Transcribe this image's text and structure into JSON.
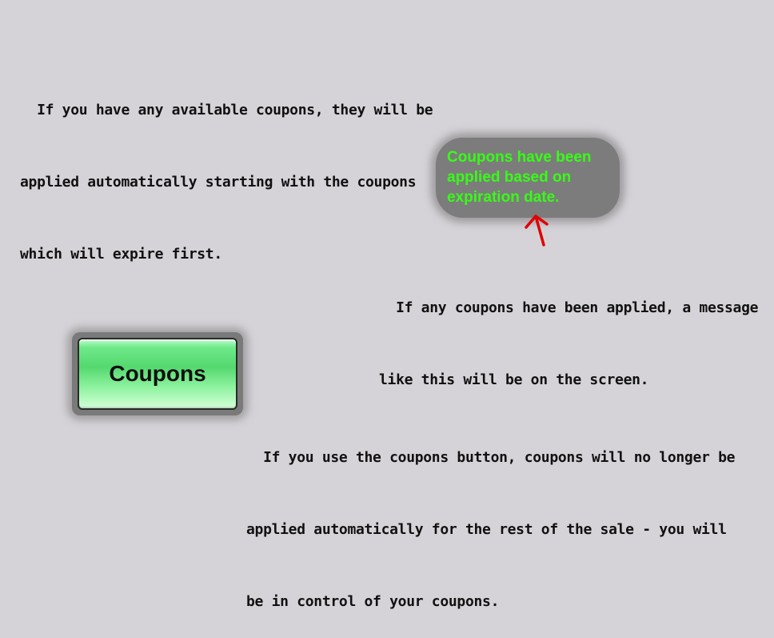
{
  "notes": {
    "auto_apply": [
      "  If you have any available coupons, they will be",
      "applied automatically starting with the coupons",
      "which will expire first."
    ],
    "applied_message": [
      "  If any coupons have been applied, a message",
      "like this will be on the screen."
    ],
    "coupons_button": [
      "  If you use the coupons button, coupons will no longer be",
      "applied automatically for the rest of the sale - you will",
      "be in control of your coupons."
    ]
  },
  "toast": {
    "lines": [
      "Coupons have been",
      "applied based on",
      "expiration date."
    ],
    "text_color": "#35ff14",
    "background_color": "#7c7c7c"
  },
  "button": {
    "label": "Coupons",
    "color": "#54d86e"
  },
  "annotation": {
    "arrow_color": "#e00000",
    "icon": "arrow-up-icon"
  }
}
